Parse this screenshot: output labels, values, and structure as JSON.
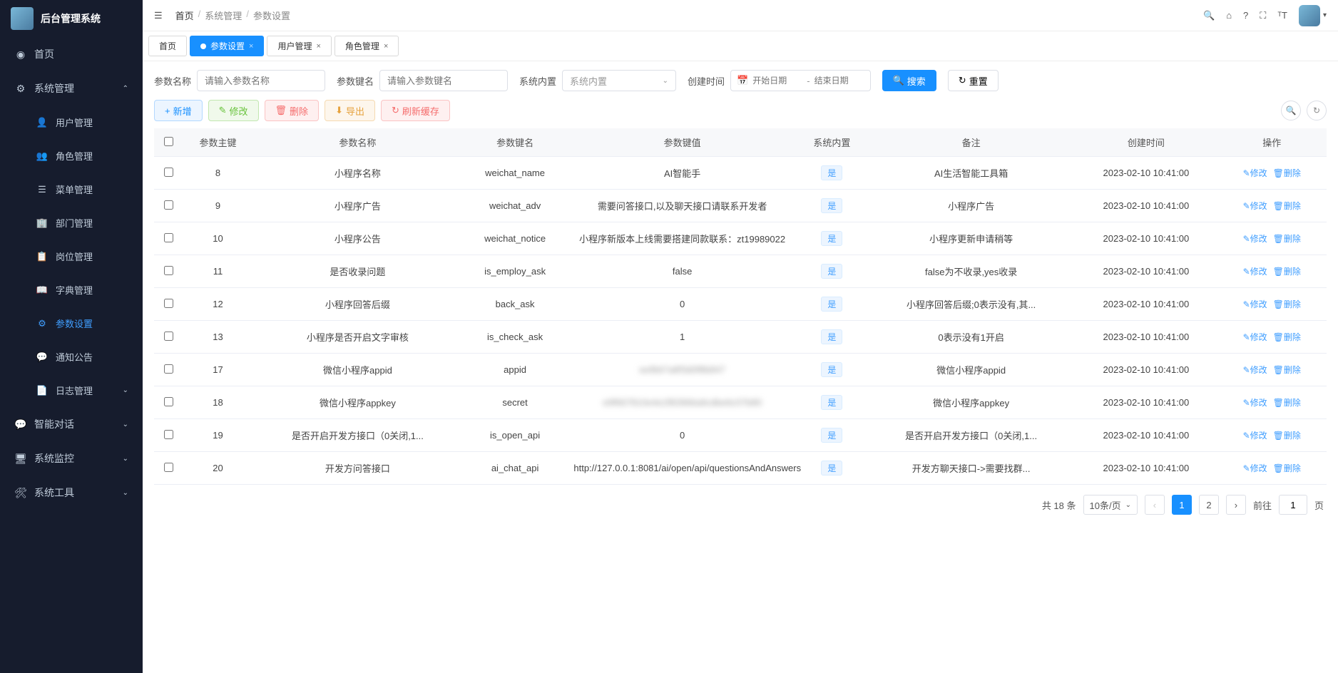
{
  "app": {
    "title": "后台管理系统"
  },
  "breadcrumb": {
    "home": "首页",
    "group": "系统管理",
    "page": "参数设置"
  },
  "tabs": [
    {
      "label": "首页",
      "active": false,
      "closable": false
    },
    {
      "label": "参数设置",
      "active": true,
      "closable": true
    },
    {
      "label": "用户管理",
      "active": false,
      "closable": true
    },
    {
      "label": "角色管理",
      "active": false,
      "closable": true
    }
  ],
  "sidebar": {
    "home": "首页",
    "sysmgmt": "系统管理",
    "items": [
      "用户管理",
      "角色管理",
      "菜单管理",
      "部门管理",
      "岗位管理",
      "字典管理",
      "参数设置",
      "通知公告",
      "日志管理"
    ],
    "groups": [
      "智能对话",
      "系统监控",
      "系统工具"
    ]
  },
  "search": {
    "name_label": "参数名称",
    "name_placeholder": "请输入参数名称",
    "key_label": "参数键名",
    "key_placeholder": "请输入参数键名",
    "builtin_label": "系统内置",
    "builtin_placeholder": "系统内置",
    "time_label": "创建时间",
    "start_placeholder": "开始日期",
    "end_placeholder": "结束日期",
    "search_btn": "搜索",
    "reset_btn": "重置"
  },
  "toolbar": {
    "add": "新增",
    "edit": "修改",
    "delete": "删除",
    "export": "导出",
    "refresh_cache": "刷新缓存"
  },
  "table": {
    "headers": [
      "参数主键",
      "参数名称",
      "参数键名",
      "参数键值",
      "系统内置",
      "备注",
      "创建时间",
      "操作"
    ],
    "builtin_yes": "是",
    "action_edit": "修改",
    "action_delete": "删除",
    "rows": [
      {
        "id": "8",
        "name": "小程序名称",
        "key": "weichat_name",
        "value": "AI智能手",
        "builtin": true,
        "remark": "AI生活智能工具箱",
        "time": "2023-02-10 10:41:00"
      },
      {
        "id": "9",
        "name": "小程序广告",
        "key": "weichat_adv",
        "value": "需要问答接口,以及聊天接口请联系开发者",
        "builtin": true,
        "remark": "小程序广告",
        "time": "2023-02-10 10:41:00"
      },
      {
        "id": "10",
        "name": "小程序公告",
        "key": "weichat_notice",
        "value": "小程序新版本上线需要搭建同款联系：zt19989022",
        "builtin": true,
        "remark": "小程序更新申请稍等",
        "time": "2023-02-10 10:41:00"
      },
      {
        "id": "11",
        "name": "是否收录问题",
        "key": "is_employ_ask",
        "value": "false",
        "builtin": true,
        "remark": "false为不收录,yes收录",
        "time": "2023-02-10 10:41:00"
      },
      {
        "id": "12",
        "name": "小程序回答后缀",
        "key": "back_ask",
        "value": "0",
        "builtin": true,
        "remark": "小程序回答后缀;0表示没有,其...",
        "time": "2023-02-10 10:41:00"
      },
      {
        "id": "13",
        "name": "小程序是否开启文字审核",
        "key": "is_check_ask",
        "value": "1",
        "builtin": true,
        "remark": "0表示没有1开启",
        "time": "2023-02-10 10:41:00"
      },
      {
        "id": "17",
        "name": "微信小程序appid",
        "key": "appid",
        "value": "wxfb67a8f3d0f8b847",
        "builtin": true,
        "remark": "微信小程序appid",
        "time": "2023-02-10 10:41:00",
        "blur": true
      },
      {
        "id": "18",
        "name": "微信小程序appkey",
        "key": "secret",
        "value": "e9f667810e4e1f82866a9cdbe6c07b80",
        "builtin": true,
        "remark": "微信小程序appkey",
        "time": "2023-02-10 10:41:00",
        "blur": true
      },
      {
        "id": "19",
        "name": "是否开启开发方接口（0关闭,1...",
        "key": "is_open_api",
        "value": "0",
        "builtin": true,
        "remark": "是否开启开发方接口（0关闭,1...",
        "time": "2023-02-10 10:41:00"
      },
      {
        "id": "20",
        "name": "开发方问答接口",
        "key": "ai_chat_api",
        "value": "http://127.0.0.1:8081/ai/open/api/questionsAndAnswers",
        "builtin": true,
        "remark": "开发方聊天接口-&gt;需要找群...",
        "time": "2023-02-10 10:41:00"
      }
    ]
  },
  "pagination": {
    "total_text": "共 18 条",
    "page_size": "10条/页",
    "current": "1",
    "page2": "2",
    "goto_prefix": "前往",
    "goto_value": "1",
    "goto_suffix": "页"
  }
}
